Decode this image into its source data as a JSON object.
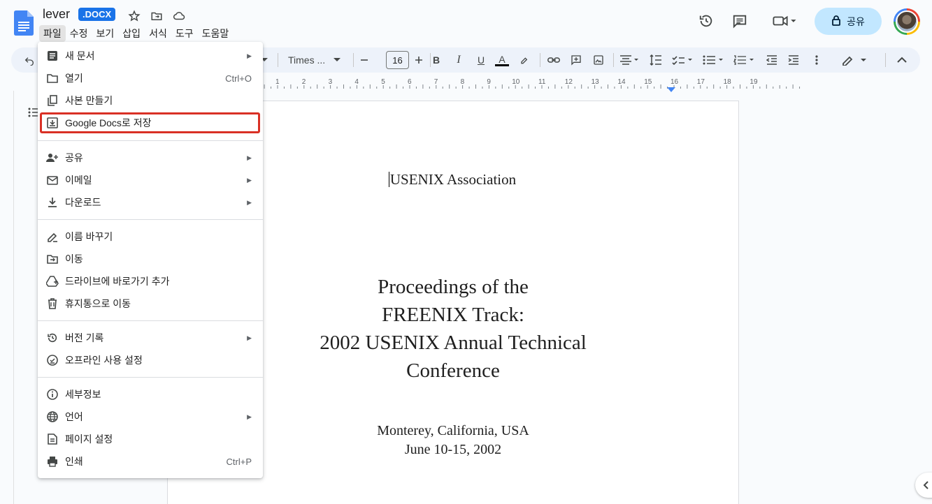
{
  "document": {
    "title": "lever",
    "format_badge": ".DOCX"
  },
  "menubar": [
    "파일",
    "수정",
    "보기",
    "삽입",
    "서식",
    "도구",
    "도움말"
  ],
  "header_right": {
    "share_label": "공유"
  },
  "toolbar": {
    "font_name": "Times ...",
    "font_size": "16"
  },
  "ruler": {
    "numbers": [
      "1",
      "2",
      "3",
      "4",
      "5",
      "6",
      "7",
      "8",
      "9",
      "10",
      "11",
      "12",
      "13",
      "14",
      "15",
      "16",
      "17",
      "18",
      "19"
    ]
  },
  "file_menu": {
    "items": [
      {
        "label": "새 문서",
        "icon": "new-doc-icon",
        "shortcut": "",
        "submenu": true
      },
      {
        "label": "열기",
        "icon": "folder-icon",
        "shortcut": "Ctrl+O",
        "submenu": false
      },
      {
        "label": "사본 만들기",
        "icon": "copy-icon",
        "shortcut": "",
        "submenu": false
      },
      {
        "label": "Google Docs로 저장",
        "icon": "save-download-icon",
        "shortcut": "",
        "submenu": false
      },
      {
        "label": "공유",
        "icon": "person-add-icon",
        "shortcut": "",
        "submenu": true
      },
      {
        "label": "이메일",
        "icon": "mail-icon",
        "shortcut": "",
        "submenu": true
      },
      {
        "label": "다운로드",
        "icon": "download-icon",
        "shortcut": "",
        "submenu": true
      },
      {
        "label": "이름 바꾸기",
        "icon": "rename-icon",
        "shortcut": "",
        "submenu": false
      },
      {
        "label": "이동",
        "icon": "move-folder-icon",
        "shortcut": "",
        "submenu": false
      },
      {
        "label": "드라이브에 바로가기 추가",
        "icon": "drive-shortcut-icon",
        "shortcut": "",
        "submenu": false
      },
      {
        "label": "휴지통으로 이동",
        "icon": "trash-icon",
        "shortcut": "",
        "submenu": false
      },
      {
        "label": "버전 기록",
        "icon": "history-icon",
        "shortcut": "",
        "submenu": true
      },
      {
        "label": "오프라인 사용 설정",
        "icon": "offline-icon",
        "shortcut": "",
        "submenu": false
      },
      {
        "label": "세부정보",
        "icon": "info-icon",
        "shortcut": "",
        "submenu": false
      },
      {
        "label": "언어",
        "icon": "globe-icon",
        "shortcut": "",
        "submenu": true
      },
      {
        "label": "페이지 설정",
        "icon": "page-setup-icon",
        "shortcut": "",
        "submenu": false
      },
      {
        "label": "인쇄",
        "icon": "print-icon",
        "shortcut": "Ctrl+P",
        "submenu": false
      }
    ]
  },
  "page_content": {
    "header": "USENIX Association",
    "title_lines": [
      "Proceedings of the",
      "FREENIX Track:",
      "2002 USENIX Annual Technical",
      "Conference"
    ],
    "location": "Monterey, California, USA",
    "dates": "June 10-15, 2002"
  },
  "colors": {
    "accent": "#1a73e8",
    "share_bg": "#c2e7ff",
    "highlight_border": "#d93025"
  }
}
